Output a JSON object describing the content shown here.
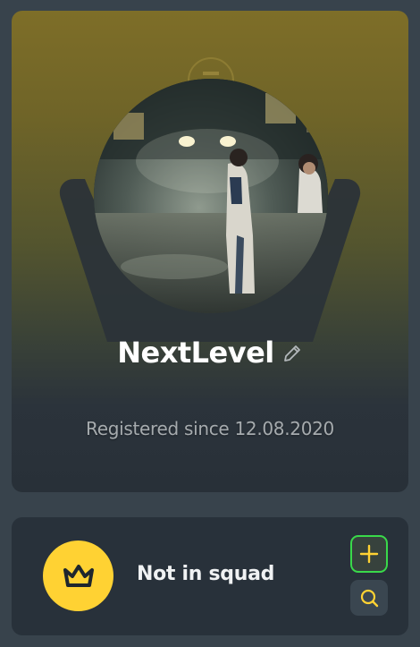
{
  "profile": {
    "username": "NextLevel",
    "registered_text": "Registered since 12.08.2020"
  },
  "squad": {
    "status_text": "Not in squad"
  },
  "icons": {
    "edit": "pencil-icon",
    "emblem": "rank-emblem-icon",
    "crown": "crown-icon",
    "add": "plus-icon",
    "search": "search-icon"
  },
  "colors": {
    "background": "#38434c",
    "card": "#28313a",
    "accent_yellow": "#ffd233",
    "accent_green": "#39d94a",
    "text_primary": "#ffffff",
    "text_muted": "#a6abae"
  }
}
